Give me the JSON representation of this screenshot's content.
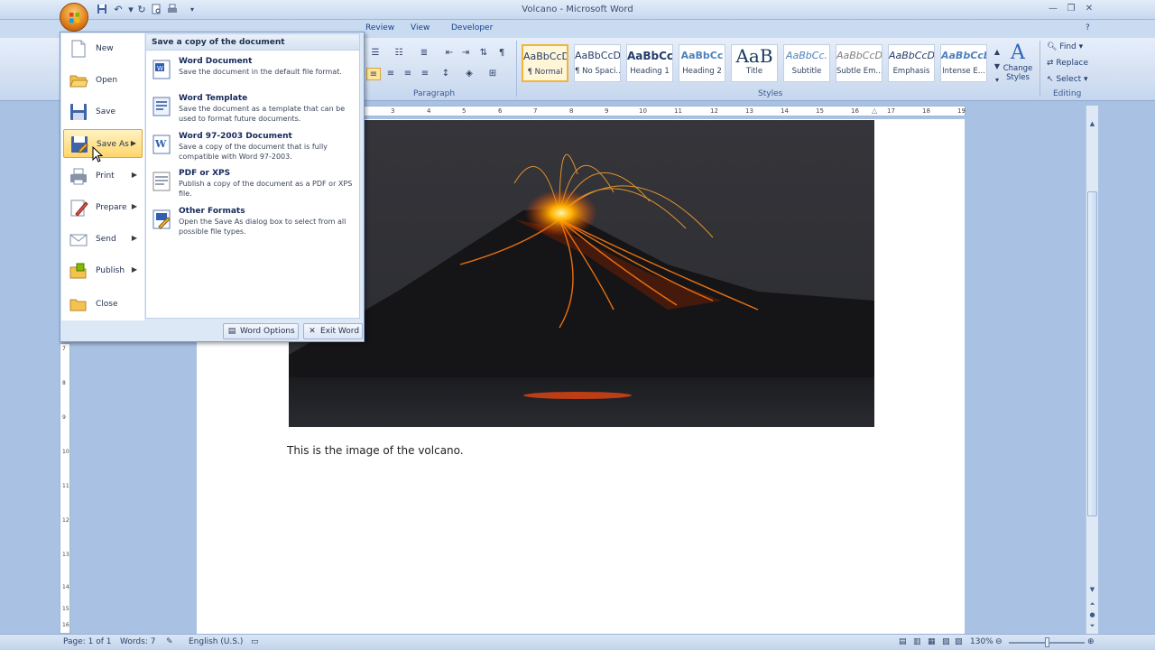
{
  "window": {
    "title": "Volcano - Microsoft Word"
  },
  "quick_access": {
    "icons": [
      "save-icon",
      "undo-icon",
      "redo-icon",
      "print-preview-icon",
      "quick-print-icon",
      "customize-icon"
    ]
  },
  "ribbon": {
    "tabs": [
      "Review",
      "View",
      "Developer"
    ],
    "groups": {
      "paragraph_label": "Paragraph",
      "styles_label": "Styles",
      "editing_label": "Editing"
    },
    "styles": [
      {
        "sample": "AaBbCcDc",
        "name": "¶ Normal",
        "selected": true
      },
      {
        "sample": "AaBbCcDc",
        "name": "¶ No Spaci...",
        "selected": false
      },
      {
        "sample": "AaBbCc",
        "name": "Heading 1",
        "selected": false
      },
      {
        "sample": "AaBbCc",
        "name": "Heading 2",
        "selected": false
      },
      {
        "sample": "AaB",
        "name": "Title",
        "selected": false
      },
      {
        "sample": "AaBbCc.",
        "name": "Subtitle",
        "selected": false
      },
      {
        "sample": "AaBbCcDc",
        "name": "Subtle Em...",
        "selected": false
      },
      {
        "sample": "AaBbCcDc",
        "name": "Emphasis",
        "selected": false
      },
      {
        "sample": "AaBbCcDc",
        "name": "Intense E...",
        "selected": false
      }
    ],
    "change_styles": "Change Styles",
    "editing": {
      "find": "Find",
      "replace": "Replace",
      "select": "Select"
    }
  },
  "office_menu": {
    "items": [
      {
        "label": "New",
        "icon": "new-document-icon",
        "has_submenu": false
      },
      {
        "label": "Open",
        "icon": "open-folder-icon",
        "has_submenu": false
      },
      {
        "label": "Save",
        "icon": "save-icon",
        "has_submenu": false
      },
      {
        "label": "Save As",
        "icon": "save-as-icon",
        "has_submenu": true
      },
      {
        "label": "Print",
        "icon": "printer-icon",
        "has_submenu": true
      },
      {
        "label": "Prepare",
        "icon": "prepare-icon",
        "has_submenu": true
      },
      {
        "label": "Send",
        "icon": "send-icon",
        "has_submenu": true
      },
      {
        "label": "Publish",
        "icon": "publish-icon",
        "has_submenu": true
      },
      {
        "label": "Close",
        "icon": "close-folder-icon",
        "has_submenu": false
      }
    ],
    "active_item": "Save As",
    "submenu": {
      "header": "Save a copy of the document",
      "items": [
        {
          "title": "Word Document",
          "desc": "Save the document in the default file format.",
          "icon": "word-document-icon"
        },
        {
          "title": "Word Template",
          "desc": "Save the document as a template that can be used to format future documents.",
          "icon": "word-template-icon"
        },
        {
          "title": "Word 97-2003 Document",
          "desc": "Save a copy of the document that is fully compatible with Word 97-2003.",
          "icon": "word-97-2003-icon"
        },
        {
          "title": "PDF or XPS",
          "desc": "Publish a copy of the document as a PDF or XPS file.",
          "icon": "pdf-xps-icon"
        },
        {
          "title": "Other Formats",
          "desc": "Open the Save As dialog box to select from all possible file types.",
          "icon": "other-formats-icon"
        }
      ]
    },
    "footer": {
      "word_options": "Word Options",
      "exit_word": "Exit Word"
    }
  },
  "ruler": {
    "horizontal_ticks": [
      "3",
      "4",
      "5",
      "6",
      "7",
      "8",
      "9",
      "10",
      "11",
      "12",
      "13",
      "14",
      "15",
      "16",
      "17",
      "18",
      "19"
    ],
    "vertical_ticks": [
      "7",
      "8",
      "9",
      "10",
      "11",
      "12",
      "13",
      "14",
      "15",
      "16"
    ]
  },
  "document": {
    "image_name": "volcano-image",
    "body_text": "This is the image of the volcano."
  },
  "status_bar": {
    "page": "Page: 1 of 1",
    "words": "Words: 7",
    "language": "English (U.S.)",
    "zoom": "130%"
  },
  "colors": {
    "office_blue": "#c9dbf1",
    "menu_highlight": "#ffd66b",
    "lava": "#ff6a00"
  }
}
